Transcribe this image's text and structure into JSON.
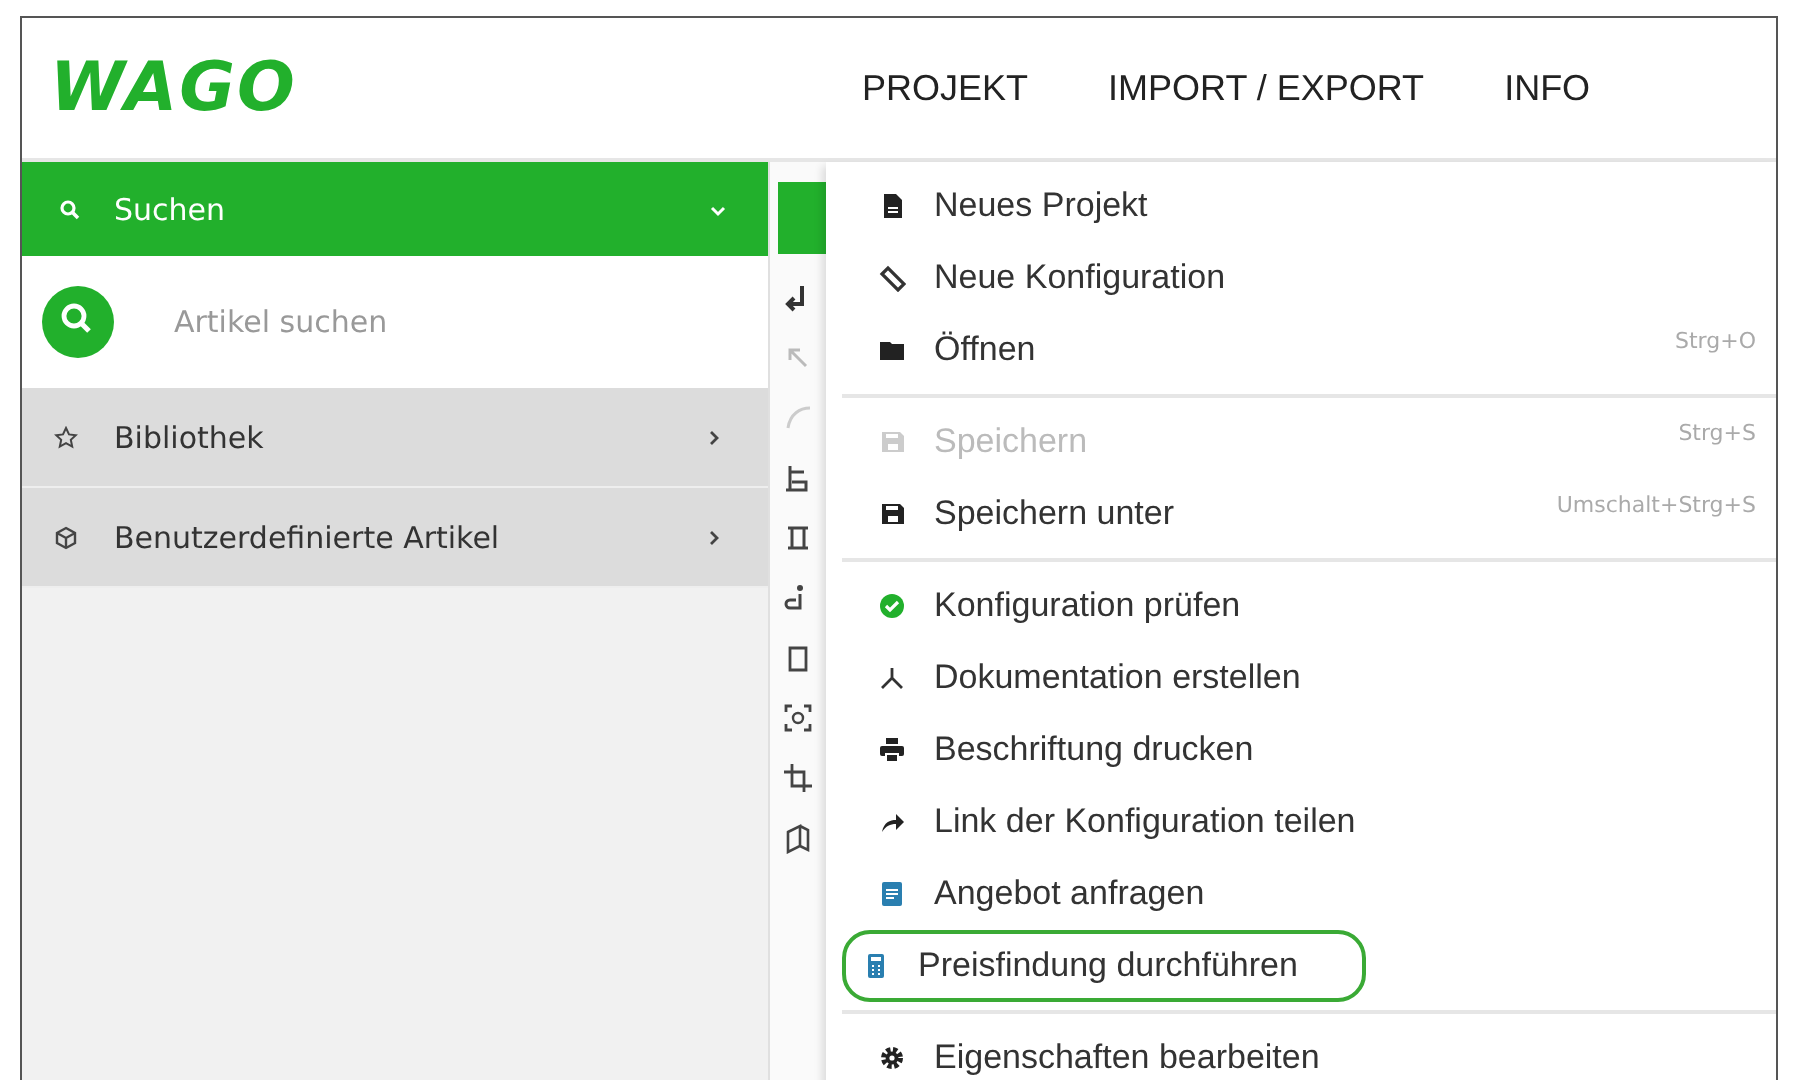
{
  "header": {
    "logo": "WAGO",
    "nav": [
      {
        "label": "PROJEKT"
      },
      {
        "label": "IMPORT / EXPORT"
      },
      {
        "label": "INFO"
      }
    ]
  },
  "sidebar": {
    "section": {
      "label": "Suchen",
      "expanded": true
    },
    "search": {
      "placeholder": "Artikel suchen"
    },
    "items": [
      {
        "label": "Bibliothek"
      },
      {
        "label": "Benutzerdefinierte Artikel"
      }
    ]
  },
  "menu": {
    "groups": [
      [
        {
          "label": "Neues Projekt",
          "disabled": false,
          "highlighted": false
        },
        {
          "label": "Neue Konfiguration",
          "disabled": false,
          "highlighted": false
        },
        {
          "label": "Öffnen",
          "shortcut": "Strg+O",
          "disabled": false,
          "highlighted": false
        }
      ],
      [
        {
          "label": "Speichern",
          "shortcut": "Strg+S",
          "disabled": true,
          "highlighted": false
        },
        {
          "label": "Speichern unter",
          "shortcut": "Umschalt+Strg+S",
          "disabled": false,
          "highlighted": false
        }
      ],
      [
        {
          "label": "Konfiguration prüfen",
          "disabled": false,
          "highlighted": false
        },
        {
          "label": "Dokumentation erstellen",
          "disabled": false,
          "highlighted": false
        },
        {
          "label": "Beschriftung drucken",
          "disabled": false,
          "highlighted": false
        },
        {
          "label": "Link der Konfiguration teilen",
          "disabled": false,
          "highlighted": false
        },
        {
          "label": "Angebot anfragen",
          "disabled": false,
          "highlighted": false
        },
        {
          "label": "Preisfindung durchführen",
          "disabled": false,
          "highlighted": true
        }
      ],
      [
        {
          "label": "Eigenschaften bearbeiten",
          "disabled": false,
          "highlighted": false
        }
      ]
    ]
  }
}
